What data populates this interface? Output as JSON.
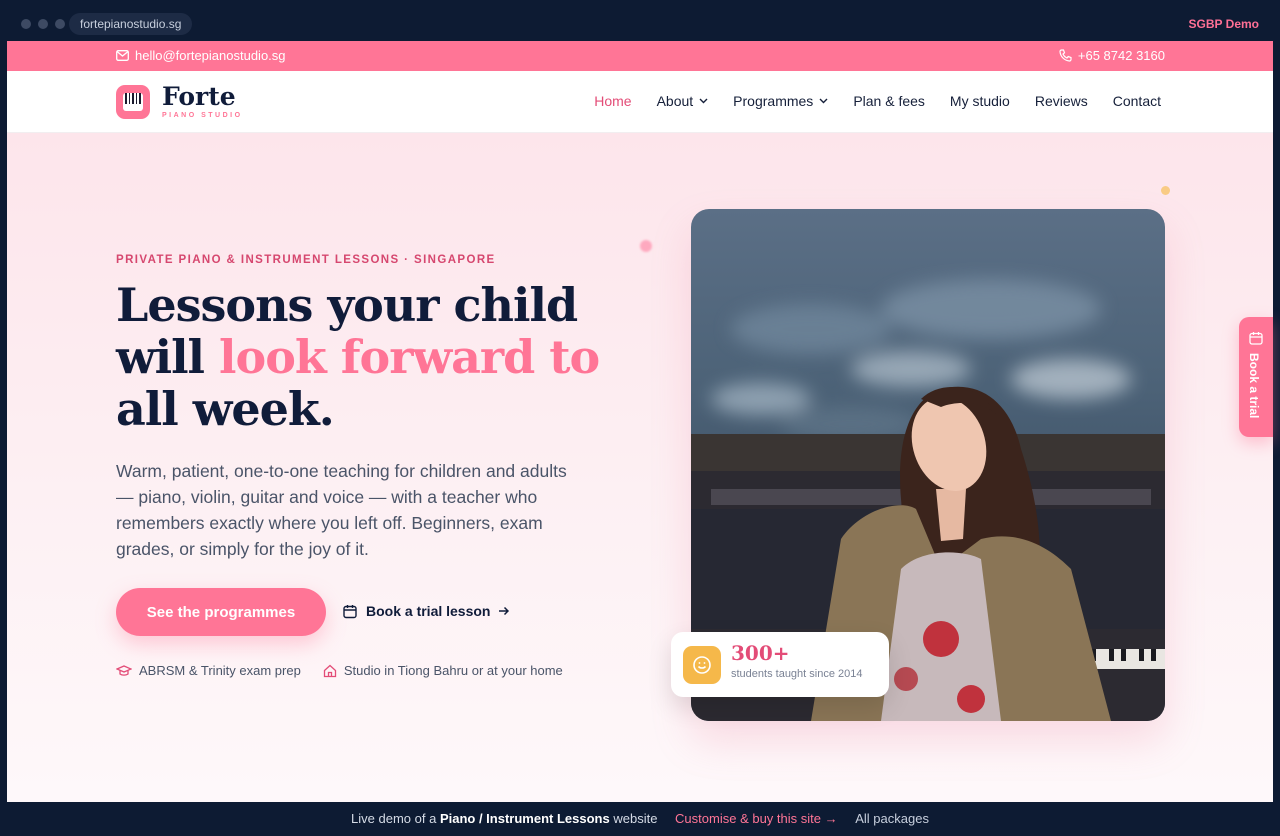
{
  "browser": {
    "url": "fortepianostudio.sg",
    "demo_label": "SGBP Demo"
  },
  "topbar": {
    "email": "hello@fortepianostudio.sg",
    "phone": "+65 8742 3160"
  },
  "brand": {
    "name": "Forte",
    "tagline": "PIANO STUDIO",
    "accent": "#ff7596",
    "navy": "#101c3a"
  },
  "nav": {
    "items": [
      {
        "label": "Home",
        "active": true,
        "dropdown": false
      },
      {
        "label": "About",
        "active": false,
        "dropdown": true
      },
      {
        "label": "Programmes",
        "active": false,
        "dropdown": true
      },
      {
        "label": "Plan & fees",
        "active": false,
        "dropdown": false
      },
      {
        "label": "My studio",
        "active": false,
        "dropdown": false
      },
      {
        "label": "Reviews",
        "active": false,
        "dropdown": false
      },
      {
        "label": "Contact",
        "active": false,
        "dropdown": false
      }
    ]
  },
  "hero": {
    "eyebrow": "PRIVATE PIANO & INSTRUMENT LESSONS · SINGAPORE",
    "headline_a": "Lessons your child will",
    "headline_pink": "look forward to",
    "headline_b": "all",
    "headline_c": "week.",
    "lede": "Warm, patient, one-to-one teaching for children and adults — piano, violin, guitar and voice — with a teacher who remembers exactly where you left off. Beginners, exam grades, or simply for the joy of it.",
    "primary_cta": "See the programmes",
    "secondary_cta": "Book a trial lesson",
    "badges": [
      {
        "icon": "graduation-cap-icon",
        "label": "ABRSM & Trinity exam prep"
      },
      {
        "icon": "home-icon",
        "label": "Studio in Tiong Bahru or at your home"
      }
    ],
    "stat": {
      "number": "300+",
      "caption": "students taught since 2014"
    }
  },
  "side_tab": {
    "label": "Book a trial"
  },
  "demo_bar": {
    "prefix": "Live demo of a",
    "site_type": "Piano / Instrument Lessons",
    "suffix": "website",
    "customise": "Customise & buy this site →",
    "packages": "All packages"
  }
}
